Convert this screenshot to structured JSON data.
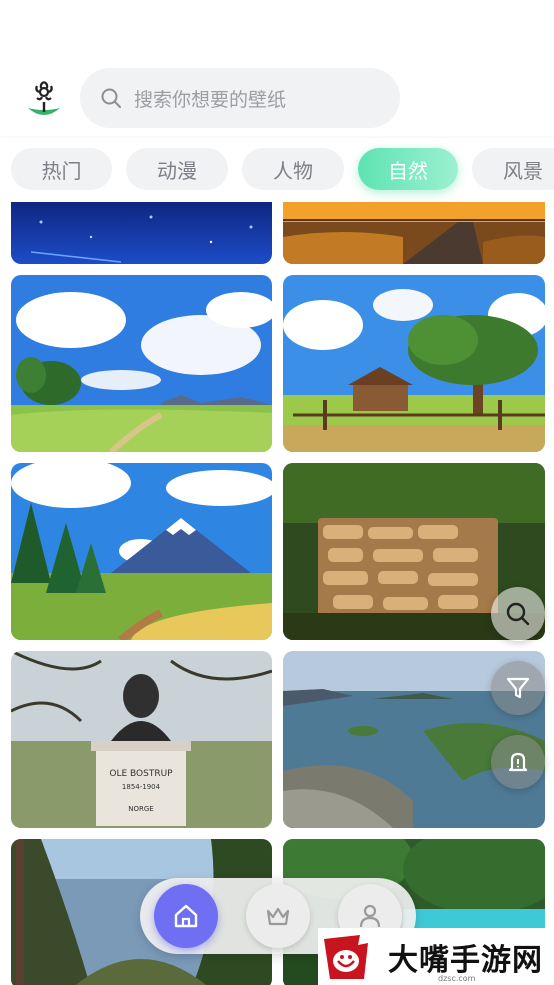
{
  "search": {
    "placeholder": "搜索你想要的壁纸"
  },
  "tabs": [
    {
      "label": "热门",
      "active": false
    },
    {
      "label": "动漫",
      "active": false
    },
    {
      "label": "人物",
      "active": false
    },
    {
      "label": "自然",
      "active": true
    },
    {
      "label": "风景",
      "active": false
    }
  ],
  "wallpapers": [
    {
      "subject": "starry blue night (anime)"
    },
    {
      "subject": "sunset country road (anime)"
    },
    {
      "subject": "grassland under blue sky with clouds (anime)"
    },
    {
      "subject": "farmhouse and big tree (anime)"
    },
    {
      "subject": "snow mountain and pine trees (anime)"
    },
    {
      "subject": "stacked firewood"
    },
    {
      "subject": "bust statue monument"
    },
    {
      "subject": "fjord landscape"
    },
    {
      "subject": "forest cliff"
    },
    {
      "subject": "tropical lagoon"
    }
  ],
  "monument_plaque": {
    "line1": "OLE BOSTRUP",
    "line2": "1854-1904",
    "line3": "NORGE"
  },
  "floating_actions": [
    "search-icon",
    "filter-icon",
    "bell-icon"
  ],
  "bottom_nav": [
    "home-icon",
    "crown-icon",
    "person-icon"
  ],
  "watermark": {
    "text": "大嘴手游网",
    "url": "dzsc.com"
  },
  "colors": {
    "accent": "#5ee3b3",
    "nav_active": "#6e6ff2"
  }
}
